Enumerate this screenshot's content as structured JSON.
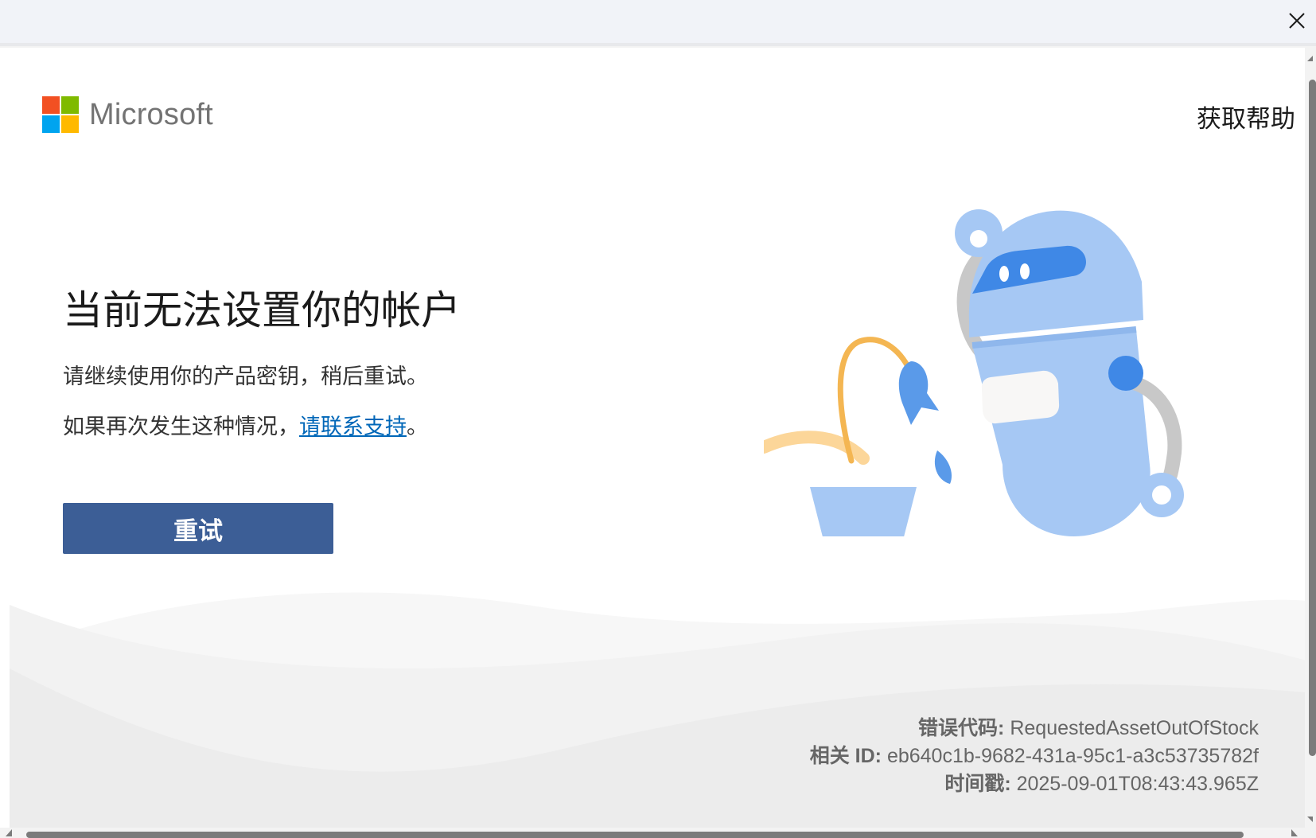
{
  "window": {
    "close_icon": "close-icon"
  },
  "brand": {
    "name": "Microsoft",
    "logo_colors": [
      "#f25022",
      "#7fba00",
      "#00a4ef",
      "#ffb900"
    ]
  },
  "header": {
    "help_link": "获取帮助"
  },
  "main": {
    "title": "当前无法设置你的帐户",
    "line1": "请继续使用你的产品密钥，稍后重试。",
    "line2_prefix": "如果再次发生这种情况，",
    "line2_link": "请联系支持",
    "line2_suffix": "。",
    "retry_button": "重试"
  },
  "error_info": {
    "code_label": "错误代码:",
    "code_value": "RequestedAssetOutOfStock",
    "correlation_label": "相关 ID:",
    "correlation_value": "eb640c1b-9682-431a-95c1-a3c53735782f",
    "timestamp_label": "时间戳:",
    "timestamp_value": "2025-09-01T08:43:43.965Z"
  },
  "colors": {
    "accent_button": "#3c5e96",
    "link": "#0067b8",
    "illustration_light_blue": "#a6c8f4",
    "illustration_blue": "#3f88e6"
  }
}
